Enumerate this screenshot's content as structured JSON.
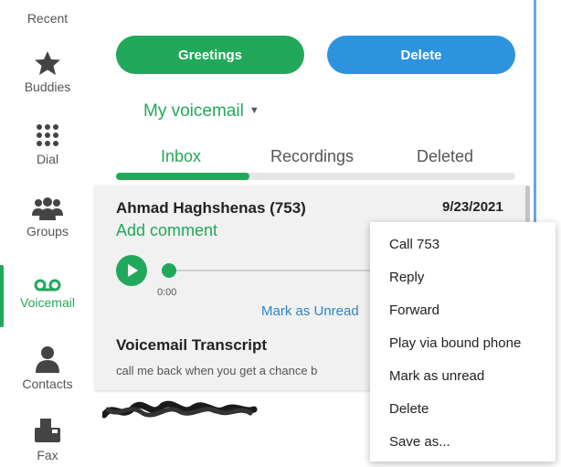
{
  "sidebar": {
    "items": [
      {
        "label": "Recent",
        "icon": "clock-icon"
      },
      {
        "label": "Buddies",
        "icon": "star-icon"
      },
      {
        "label": "Dial",
        "icon": "dialpad-icon"
      },
      {
        "label": "Groups",
        "icon": "group-icon"
      },
      {
        "label": "Voicemail",
        "icon": "voicemail-icon",
        "active": true
      },
      {
        "label": "Contacts",
        "icon": "person-icon"
      },
      {
        "label": "Fax",
        "icon": "fax-icon"
      }
    ]
  },
  "toolbar": {
    "greetings_label": "Greetings",
    "delete_label": "Delete"
  },
  "mailbox": {
    "selected": "My voicemail"
  },
  "tabs": [
    {
      "label": "Inbox",
      "active": true
    },
    {
      "label": "Recordings"
    },
    {
      "label": "Deleted"
    }
  ],
  "voicemail": {
    "caller": "Ahmad Haghshenas (753)",
    "date": "9/23/2021",
    "add_comment": "Add comment",
    "time": "0:00",
    "mark_unread": "Mark as Unread",
    "transcript_title": "Voicemail Transcript",
    "transcript_text": "call me back when you get a chance b"
  },
  "context_menu": {
    "items": [
      "Call 753",
      "Reply",
      "Forward",
      "Play via bound phone",
      "Mark as unread",
      "Delete",
      "Save as..."
    ]
  },
  "colors": {
    "accent_green": "#22a85a",
    "accent_blue": "#2d93de",
    "link_blue": "#2d85c8"
  }
}
